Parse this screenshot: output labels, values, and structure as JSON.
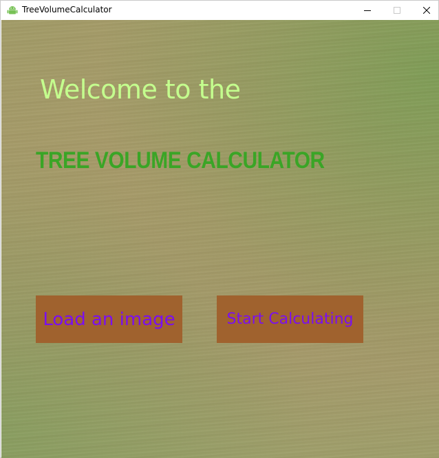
{
  "window": {
    "title": "TreeVolumeCalculator",
    "icon": "android-icon",
    "controls": {
      "minimize": "minimize-icon",
      "maximize": "maximize-icon",
      "close": "close-icon"
    }
  },
  "main": {
    "welcome_text": "Welcome to the",
    "app_name": "TREE VOLUME CALCULATOR",
    "buttons": {
      "load_image": "Load an image",
      "start_calculating": "Start Calculating"
    }
  },
  "colors": {
    "welcome_text": "#c4ff8e",
    "app_name": "#3aa526",
    "button_background": "#a0622e",
    "button_text": "#7a0ff0"
  }
}
